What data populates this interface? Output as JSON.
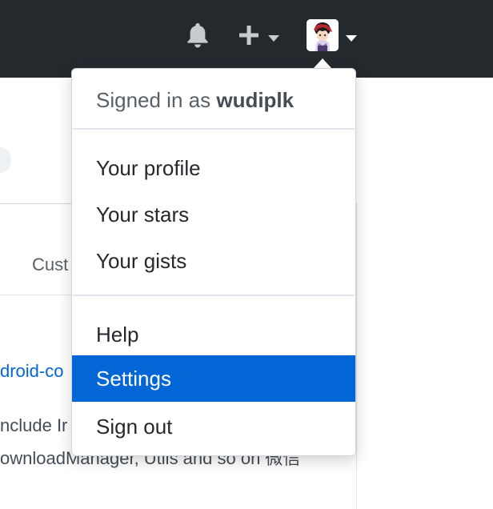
{
  "header": {
    "icons": [
      "bell-icon",
      "plus-icon",
      "chevron-down-icon",
      "avatar",
      "chevron-down-icon"
    ]
  },
  "background": {
    "tab_label": "Cust",
    "repo_link": "droid-co",
    "description_line1": "nclude Ir",
    "description_line2": "ownloadManager, Utils and so on 微信"
  },
  "menu": {
    "signed_in_prefix": "Signed in as",
    "username": "wudiplk",
    "items_group1": [
      "Your profile",
      "Your stars",
      "Your gists"
    ],
    "items_group2": [
      "Help",
      "Settings",
      "Sign out"
    ],
    "active_item": "Settings"
  },
  "colors": {
    "header_bg": "#24292e",
    "active_bg": "#0366d6",
    "link": "#0366d6"
  }
}
